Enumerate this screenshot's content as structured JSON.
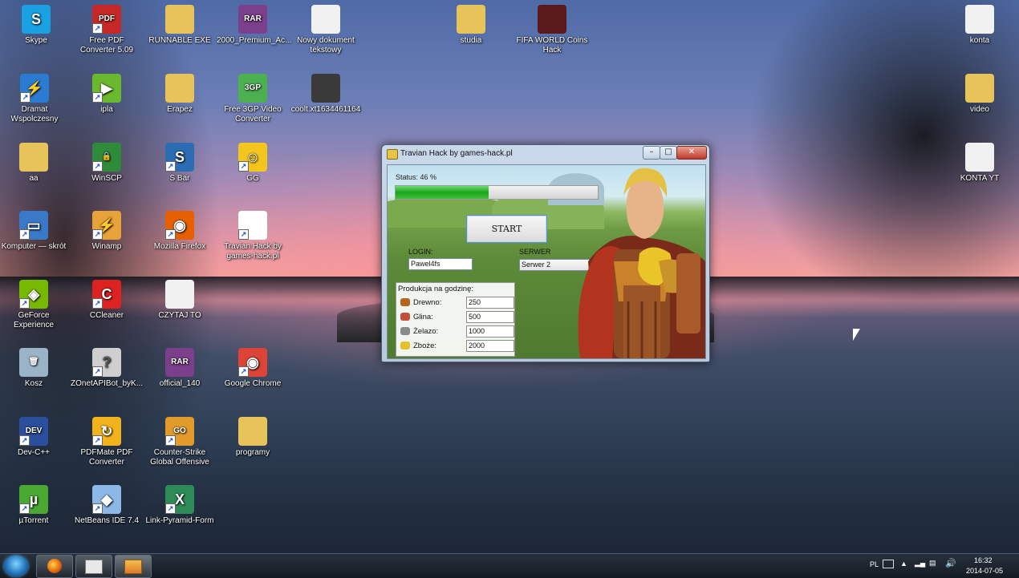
{
  "desktop": {
    "icons": [
      {
        "id": "skype",
        "label": "Skype",
        "color": "#1aa1e1",
        "glyph": "S"
      },
      {
        "id": "free-pdf",
        "label": "Free PDF Converter 5.09",
        "color": "#c62828",
        "glyph": "PDF"
      },
      {
        "id": "runnable",
        "label": "RUNNABLE EXE",
        "color": "#e7c35a",
        "glyph": ""
      },
      {
        "id": "premium",
        "label": "2000_Premium_Ac...",
        "color": "#7b3f8c",
        "glyph": "RAR"
      },
      {
        "id": "nowy-dok",
        "label": "Nowy dokument tekstowy",
        "color": "#f1f1f1",
        "glyph": ""
      },
      {
        "id": "studia",
        "label": "studia",
        "color": "#e7c35a",
        "glyph": ""
      },
      {
        "id": "fifa",
        "label": "FIFA WORLD Coins Hack",
        "color": "#5b1a1a",
        "glyph": ""
      },
      {
        "id": "konta",
        "label": "konta",
        "color": "#f1f1f1",
        "glyph": ""
      },
      {
        "id": "dramat",
        "label": "Dramat Wspolczesny",
        "color": "#2c7bd3",
        "glyph": "⚡"
      },
      {
        "id": "ipla",
        "label": "ipla",
        "color": "#6ab82e",
        "glyph": "▶"
      },
      {
        "id": "erapez",
        "label": "Erapez",
        "color": "#e7c35a",
        "glyph": ""
      },
      {
        "id": "free3gp",
        "label": "Free 3GP Video Converter",
        "color": "#4caf50",
        "glyph": "3GP"
      },
      {
        "id": "coolt",
        "label": "coolt.xt1634461164",
        "color": "#3a3a3a",
        "glyph": ""
      },
      {
        "id": "video",
        "label": "video",
        "color": "#e7c35a",
        "glyph": ""
      },
      {
        "id": "aa",
        "label": "aa",
        "color": "#e7c35a",
        "glyph": ""
      },
      {
        "id": "winscp",
        "label": "WinSCP",
        "color": "#2f8a3a",
        "glyph": "🔒"
      },
      {
        "id": "sbar",
        "label": "S Bar",
        "color": "#2b6cb3",
        "glyph": "S"
      },
      {
        "id": "gg",
        "label": "GG",
        "color": "#f4c51d",
        "glyph": "☺"
      },
      {
        "id": "konta-yt",
        "label": "KONTA YT",
        "color": "#f1f1f1",
        "glyph": ""
      },
      {
        "id": "komputer",
        "label": "Komputer — skrót",
        "color": "#3a78c8",
        "glyph": "▭"
      },
      {
        "id": "winamp",
        "label": "Winamp",
        "color": "#e8a23a",
        "glyph": "⚡"
      },
      {
        "id": "firefox",
        "label": "Mozilla Firefox",
        "color": "#e66000",
        "glyph": "◉"
      },
      {
        "id": "travian",
        "label": "Travian Hack by games-hack.pl",
        "color": "#ffffff",
        "glyph": ""
      },
      {
        "id": "geforce",
        "label": "GeForce Experience",
        "color": "#76b900",
        "glyph": "◈"
      },
      {
        "id": "ccleaner",
        "label": "CCleaner",
        "color": "#d22",
        "glyph": "C"
      },
      {
        "id": "czytaj",
        "label": "CZYTAJ TO",
        "color": "#f1f1f1",
        "glyph": ""
      },
      {
        "id": "kosz",
        "label": "Kosz",
        "color": "#9bb3c7",
        "glyph": "🗑"
      },
      {
        "id": "zonet",
        "label": "ZOnetAPIBot_byK...",
        "color": "#cfcfcf",
        "glyph": "?"
      },
      {
        "id": "official",
        "label": "official_140",
        "color": "#7b3f8c",
        "glyph": "RAR"
      },
      {
        "id": "chrome",
        "label": "Google Chrome",
        "color": "#db4437",
        "glyph": "◉"
      },
      {
        "id": "devcpp",
        "label": "Dev-C++",
        "color": "#2b4f9c",
        "glyph": "DEV"
      },
      {
        "id": "pdfmate",
        "label": "PDFMate PDF Converter",
        "color": "#f2b21b",
        "glyph": "↻"
      },
      {
        "id": "csgo",
        "label": "Counter-Strike Global Offensive",
        "color": "#e29a2a",
        "glyph": "GO"
      },
      {
        "id": "programy",
        "label": "programy",
        "color": "#e7c35a",
        "glyph": ""
      },
      {
        "id": "utorrent",
        "label": "µTorrent",
        "color": "#4aa832",
        "glyph": "µ"
      },
      {
        "id": "netbeans",
        "label": "NetBeans IDE 7.4",
        "color": "#8cb8e8",
        "glyph": "◆"
      },
      {
        "id": "linkpyr",
        "label": "Link-Pyramid-Form",
        "color": "#2e8b57",
        "glyph": "X"
      }
    ]
  },
  "window": {
    "title": "Travian Hack by games-hack.pl",
    "status_label": "Status: 46 %",
    "progress": 0.46,
    "start_label": "START",
    "login_label": "LOGIN:",
    "login_value": "Pawel4fs",
    "server_label": "SERWER",
    "server_value": "Serwer 2",
    "production_title": "Produkcja na godzinę:",
    "resources": [
      {
        "name": "Drewno:",
        "value": "250",
        "color": "#b5651d"
      },
      {
        "name": "Glina:",
        "value": "500",
        "color": "#c0503a"
      },
      {
        "name": "Żelazo:",
        "value": "1000",
        "color": "#8a8a8a"
      },
      {
        "name": "Zboże:",
        "value": "2000",
        "color": "#e6c02a"
      }
    ],
    "controls": {
      "minimize": "–",
      "maximize": "□",
      "close": "✕"
    }
  },
  "taskbar": {
    "language": "PL",
    "time": "16:32",
    "date": "2014-07-05"
  }
}
